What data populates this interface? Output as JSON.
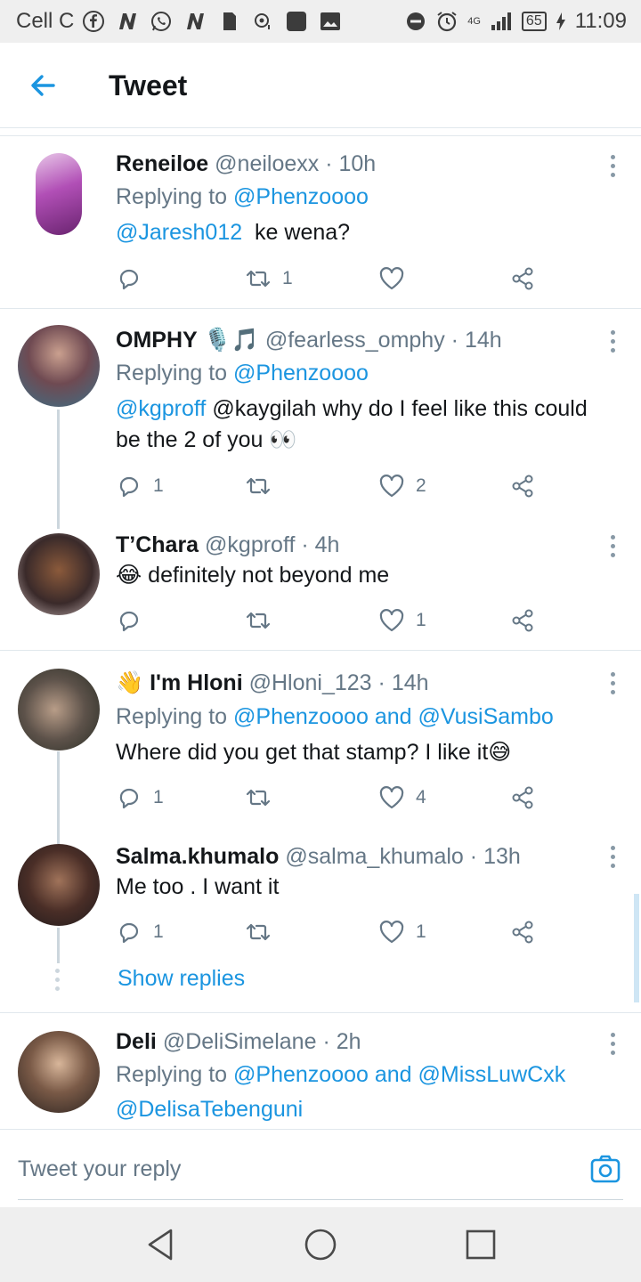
{
  "status_bar": {
    "carrier": "Cell C",
    "network": "4G",
    "battery": "65",
    "time": "11:09"
  },
  "header": {
    "title": "Tweet"
  },
  "tweets": [
    {
      "name": "Reneiloe",
      "handle": "@neiloexx",
      "time": "10h",
      "replying_prefix": "Replying to",
      "replying_to": "@Phenzoooo",
      "body_mention": "@Jaresh012",
      "body_text": "ke wena?",
      "replies": "",
      "retweets": "1",
      "likes": ""
    },
    {
      "name": "OMPHY",
      "name_emoji": "🎙️🎵",
      "handle": "@fearless_omphy",
      "time": "14h",
      "replying_prefix": "Replying to",
      "replying_to": "@Phenzoooo",
      "body_mention": "@kgproff",
      "body_text": "@kaygilah why do I feel like this could be the 2 of you 👀",
      "replies": "1",
      "retweets": "",
      "likes": "2"
    },
    {
      "name": "T’Chara",
      "handle": "@kgproff",
      "time": "4h",
      "body_emoji": "😂",
      "body_text": "definitely not beyond me",
      "replies": "",
      "retweets": "",
      "likes": "1"
    },
    {
      "name_emoji": "👋",
      "name": "I'm Hloni",
      "handle": "@Hloni_123",
      "time": "14h",
      "replying_prefix": "Replying to",
      "replying_to": "@Phenzoooo and @VusiSambo",
      "body_text": "Where did you get that stamp? I like it😅",
      "replies": "1",
      "retweets": "",
      "likes": "4"
    },
    {
      "name": "Salma.khumalo",
      "handle": "@salma_khumalo",
      "time": "13h",
      "body_text": "Me too . I want it",
      "replies": "1",
      "retweets": "",
      "likes": "1"
    },
    {
      "name": "Deli",
      "handle": "@DeliSimelane",
      "time": "2h",
      "replying_prefix": "Replying to",
      "replying_to": "@Phenzoooo and @MissLuwCxk",
      "body_mention": "@DelisaTebenguni"
    }
  ],
  "show_replies": "Show replies",
  "reply_bar": {
    "placeholder": "Tweet your reply"
  },
  "colors": {
    "accent": "#1b95e0",
    "muted": "#657786",
    "text": "#14171a"
  },
  "icons": {
    "back": "arrow-left-icon",
    "reply": "reply-bubble-icon",
    "retweet": "retweet-icon",
    "like": "heart-icon",
    "share": "share-icon",
    "more": "more-vertical-icon",
    "camera": "camera-icon"
  }
}
